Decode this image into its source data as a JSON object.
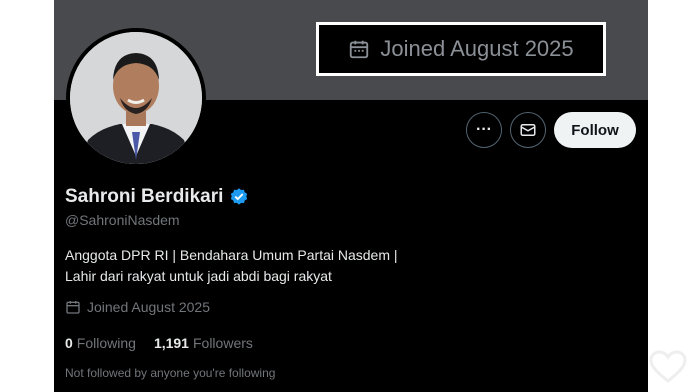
{
  "banner": {
    "callout_text": "Joined August 2025",
    "callout_icon": "calendar-icon"
  },
  "profile": {
    "display_name": "Sahroni Berdikari",
    "verified_badge": "verified-badge-icon",
    "handle": "@SahroniNasdem",
    "bio_line1": "Anggota DPR RI | Bendahara Umum Partai Nasdem |",
    "bio_line2": "Lahir dari rakyat untuk jadi abdi bagi rakyat",
    "joined": "Joined August 2025",
    "following_count": "0",
    "following_label": "Following",
    "followers_count": "1,191",
    "followers_label": "Followers",
    "follow_note": "Not followed by anyone you're following"
  },
  "actions": {
    "more_label": "···",
    "follow_label": "Follow"
  },
  "colors": {
    "background": "#000000",
    "banner": "#484a4d",
    "text_primary": "#e7e9ea",
    "text_secondary": "#71767b",
    "verified": "#1d9bf0",
    "follow_button": "#eff3f4"
  }
}
